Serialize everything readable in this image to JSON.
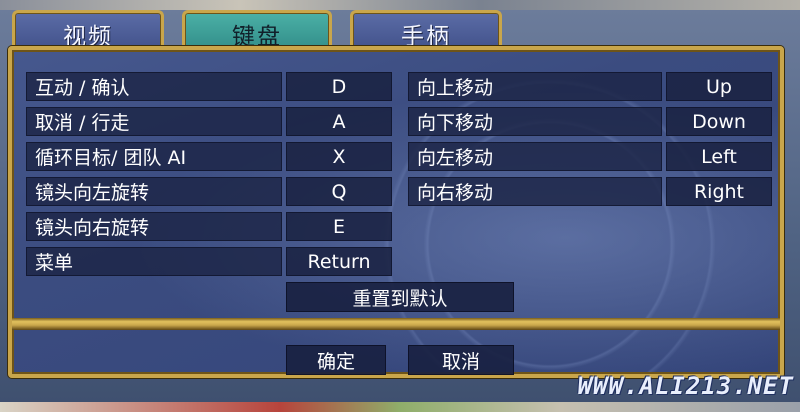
{
  "tabs": [
    {
      "label": "视频",
      "active": false
    },
    {
      "label": "键盘",
      "active": true
    },
    {
      "label": "手柄",
      "active": false
    }
  ],
  "left_bindings": [
    {
      "action": "互动 / 确认",
      "key": "D"
    },
    {
      "action": "取消 / 行走",
      "key": "A"
    },
    {
      "action": "循环目标/ 团队 AI",
      "key": "X"
    },
    {
      "action": "镜头向左旋转",
      "key": "Q"
    },
    {
      "action": "镜头向右旋转",
      "key": "E"
    },
    {
      "action": "菜单",
      "key": "Return"
    }
  ],
  "right_bindings": [
    {
      "action": "向上移动",
      "key": "Up"
    },
    {
      "action": "向下移动",
      "key": "Down"
    },
    {
      "action": "向左移动",
      "key": "Left"
    },
    {
      "action": "向右移动",
      "key": "Right"
    }
  ],
  "reset_label": "重置到默认",
  "confirm_label": "确定",
  "cancel_label": "取消",
  "watermark": "WWW.ALI213.NET",
  "colors": {
    "frame_gold": "#c9a64b",
    "panel_blue": "#3b4c80",
    "active_tab": "#2f8a86",
    "cell_bg": "#1c2446"
  }
}
